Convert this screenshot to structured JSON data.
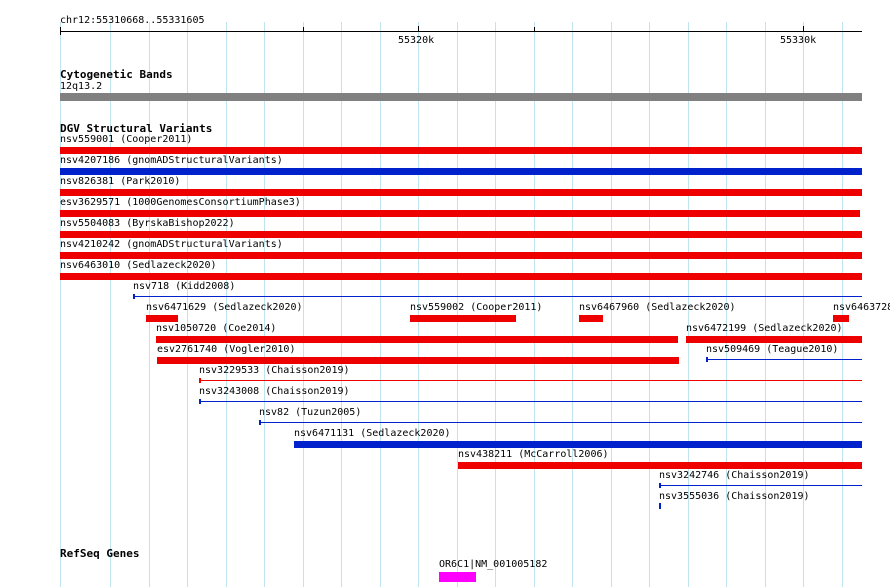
{
  "location": "chr12:55310668..55331605",
  "ruler": {
    "labels": [
      "55320k",
      "55330k"
    ]
  },
  "colors": {
    "red": "#ee0000",
    "blue": "#0022cc",
    "band": "#808080",
    "gene": "#ff00ff",
    "grid": "#bfe3ef"
  },
  "cytoband": {
    "title": "Cytogenetic Bands",
    "band_label": "12q13.2"
  },
  "dgv": {
    "title": "DGV Structural Variants",
    "variants": [
      {
        "label": "nsv559001 (Cooper2011)"
      },
      {
        "label": "nsv4207186 (gnomADStructuralVariants)"
      },
      {
        "label": "nsv826381 (Park2010)"
      },
      {
        "label": "esv3629571 (1000GenomesConsortiumPhase3)"
      },
      {
        "label": "nsv5504083 (ByrskaBishop2022)"
      },
      {
        "label": "nsv4210242 (gnomADStructuralVariants)"
      },
      {
        "label": "nsv6463010 (Sedlazeck2020)"
      },
      {
        "label": "nsv718 (Kidd2008)"
      },
      {
        "label": "nsv6471629 (Sedlazeck2020)"
      },
      {
        "label": "nsv559002 (Cooper2011)"
      },
      {
        "label": "nsv6467960 (Sedlazeck2020)"
      },
      {
        "label": "nsv6463728"
      },
      {
        "label": "nsv1050720 (Coe2014)"
      },
      {
        "label": "nsv6472199 (Sedlazeck2020)"
      },
      {
        "label": "esv2761740 (Vogler2010)"
      },
      {
        "label": "nsv509469 (Teague2010)"
      },
      {
        "label": "nsv3229533 (Chaisson2019)"
      },
      {
        "label": "nsv3243008 (Chaisson2019)"
      },
      {
        "label": "nsv82 (Tuzun2005)"
      },
      {
        "label": "nsv6471131 (Sedlazeck2020)"
      },
      {
        "label": "nsv438211 (McCarroll2006)"
      },
      {
        "label": "nsv3242746 (Chaisson2019)"
      },
      {
        "label": "nsv3555036 (Chaisson2019)"
      }
    ]
  },
  "refseq": {
    "title": "RefSeq Genes",
    "gene_label": "OR6C1|NM_001005182"
  }
}
